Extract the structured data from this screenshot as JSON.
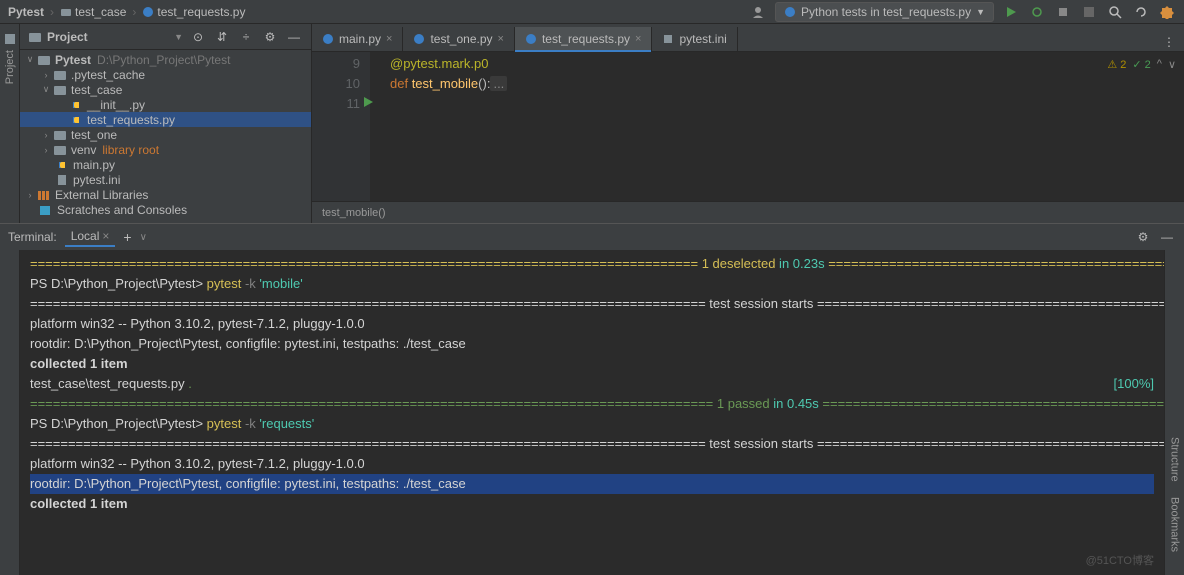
{
  "breadcrumb": {
    "root": "Pytest",
    "folder": "test_case",
    "file": "test_requests.py"
  },
  "runConfig": {
    "label": "Python tests in test_requests.py"
  },
  "projectPanel": {
    "title": "Project",
    "tree": {
      "root": "Pytest",
      "rootPath": "D:\\Python_Project\\Pytest",
      "cache": ".pytest_cache",
      "testCase": "test_case",
      "init": "__init__.py",
      "testReq": "test_requests.py",
      "testOne": "test_one",
      "venv": "venv",
      "venvHint": "library root",
      "mainPy": "main.py",
      "pytestIni": "pytest.ini",
      "extLib": "External Libraries",
      "scratches": "Scratches and Consoles"
    }
  },
  "tabs": [
    {
      "label": "main.py",
      "icon": "py"
    },
    {
      "label": "test_one.py",
      "icon": "py"
    },
    {
      "label": "test_requests.py",
      "icon": "py",
      "active": true
    },
    {
      "label": "pytest.ini",
      "icon": "ini"
    }
  ],
  "editor": {
    "lines": {
      "l9": "9",
      "l10": "10",
      "l11": "11"
    },
    "decorator": "@pytest.mark.p0",
    "defKw": "def ",
    "fnName": "test_mobile",
    "fnRest": "():",
    "fold": "...",
    "crumb": "test_mobile()"
  },
  "indicators": {
    "warn": "⚠ 2",
    "ok": "✓ 2",
    "up": "^",
    "down": "∨"
  },
  "terminal": {
    "title": "Terminal:",
    "tab": "Local",
    "lines": {
      "sep1": "======================================================================================== ",
      "desel": "1 deselected",
      "deselTime": " in 0.23s",
      "sep1b": " =========================================================================================",
      "prompt1": "PS D:\\Python_Project\\Pytest> ",
      "cmd1": "pytest",
      "flag1": " -k ",
      "arg1": "'mobile'",
      "sep2": "========================================================================================= ",
      "start": "test session starts",
      "sep2b": " =========================================================================================",
      "platform": "platform win32 -- Python 3.10.2, pytest-7.1.2, pluggy-1.0.0",
      "rootdir": "rootdir: D:\\Python_Project\\Pytest, configfile: pytest.ini, testpaths: ./test_case",
      "collected": "collected 1 item",
      "testFile": "test_case\\test_requests.py ",
      "dot": ".",
      "pct": "[100%]",
      "passSep1": "========================================================================================== ",
      "passed": "1 passed",
      "passTime": " in 0.45s",
      "passSep2": " ==========================================================================================",
      "prompt2": "PS D:\\Python_Project\\Pytest> ",
      "cmd2": "pytest",
      "flag2": " -k ",
      "arg2": "'requests'",
      "collected2": "collected 1 item"
    }
  },
  "leftRailLabel": "Project",
  "rightRails": {
    "structure": "Structure",
    "bookmarks": "Bookmarks"
  },
  "watermark": "@51CTO博客"
}
